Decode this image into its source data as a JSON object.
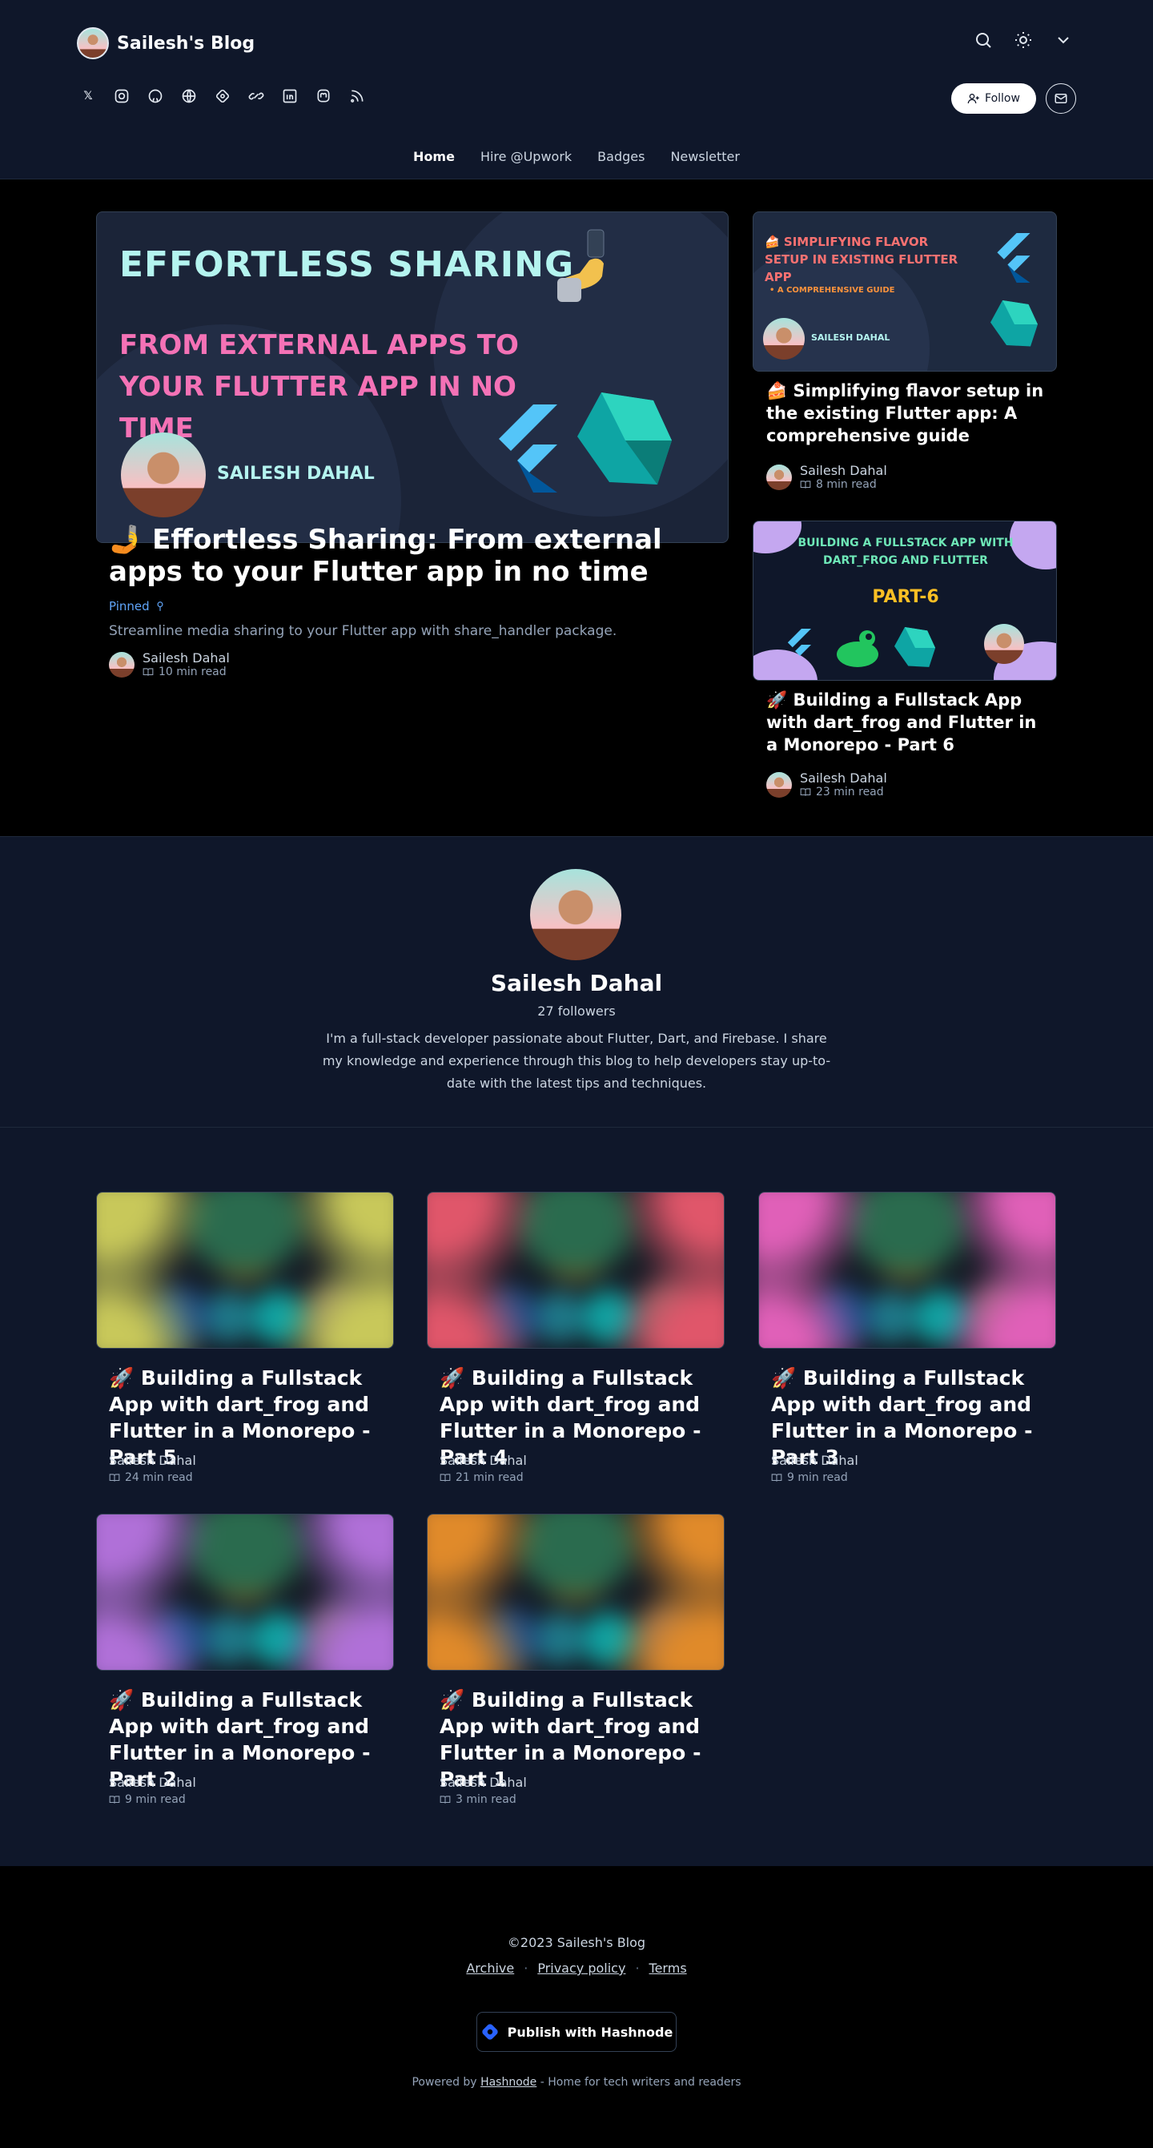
{
  "header": {
    "blog_name": "Sailesh's Blog",
    "follow_label": "Follow",
    "nav": [
      "Home",
      "Hire @Upwork",
      "Badges",
      "Newsletter"
    ],
    "social_icons": [
      "x-icon",
      "instagram-icon",
      "github-icon",
      "globe-icon",
      "hashnode-icon",
      "link-icon",
      "linkedin-icon",
      "mastodon-icon",
      "rss-icon"
    ]
  },
  "featured": {
    "image_title": "EFFORTLESS SHARING",
    "image_subtitle": "FROM EXTERNAL APPS TO YOUR FLUTTER APP IN NO TIME",
    "image_author": "SAILESH DAHAL",
    "title": "🤳 Effortless Sharing: From external apps to your Flutter app in no time",
    "pinned": "Pinned",
    "description": "Streamline media sharing to your Flutter app with share_handler package.",
    "author": "Sailesh Dahal",
    "read_time": "10 min read"
  },
  "side_posts": [
    {
      "image_title": "🍰 SIMPLIFYING FLAVOR SETUP IN EXISTING FLUTTER APP",
      "image_subtitle": "• A COMPREHENSIVE GUIDE",
      "image_author": "SAILESH DAHAL",
      "title": "🍰 Simplifying flavor setup in the existing Flutter app: A comprehensive guide",
      "author": "Sailesh Dahal",
      "read_time": "8 min read"
    },
    {
      "image_title": "BUILDING A FULLSTACK APP WITH DART_FROG AND FLUTTER",
      "image_subtitle": "PART-6",
      "title": "🚀 Building a Fullstack App with dart_frog and Flutter in a Monorepo - Part 6",
      "author": "Sailesh Dahal",
      "read_time": "23 min read"
    }
  ],
  "profile": {
    "name": "Sailesh Dahal",
    "followers": "27 followers",
    "bio": "I'm a full-stack developer passionate about Flutter, Dart, and Firebase. I share my knowledge and experience through this blog to help developers stay up-to-date with the latest tips and techniques."
  },
  "posts": [
    {
      "title": "🚀 Building a Fullstack App with dart_frog and Flutter in a Monorepo - Part 5",
      "author": "Sailesh Dahal",
      "read_time": "24 min read",
      "accent": "#c8c85a"
    },
    {
      "title": "🚀 Building a Fullstack App with dart_frog and Flutter in a Monorepo - Part 4",
      "author": "Sailesh Dahal",
      "read_time": "21 min read",
      "accent": "#e0566a"
    },
    {
      "title": "🚀 Building a Fullstack App with dart_frog and Flutter in a Monorepo - Part 3",
      "author": "Sailesh Dahal",
      "read_time": "9 min read",
      "accent": "#e060b8"
    },
    {
      "title": "🚀 Building a Fullstack App with dart_frog and Flutter in a Monorepo - Part 2",
      "author": "Sailesh Dahal",
      "read_time": "9 min read",
      "accent": "#b070d8"
    },
    {
      "title": "🚀 Building a Fullstack App with dart_frog and Flutter in a Monorepo - Part 1",
      "author": "Sailesh Dahal",
      "read_time": "3 min read",
      "accent": "#e08a2a"
    }
  ],
  "footer": {
    "copyright": "©2023 Sailesh's Blog",
    "links": [
      "Archive",
      "Privacy policy",
      "Terms"
    ],
    "publish_label": "Publish with Hashnode",
    "powered_prefix": "Powered by",
    "powered_link": "Hashnode",
    "powered_suffix": "- Home for tech writers and readers"
  },
  "colors": {
    "header_bg": "#0f172a",
    "page_bg": "#000000",
    "accent_link": "#60a5fa",
    "hero_title": "#b4f4ef",
    "hero_subtitle": "#f472b6"
  }
}
